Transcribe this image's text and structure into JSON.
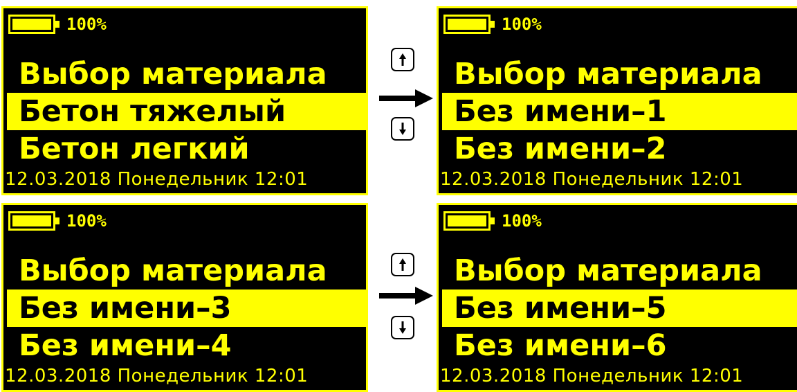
{
  "colors": {
    "screen_bg": "#000000",
    "accent": "#ffff00",
    "selected_text": "#000000",
    "page_bg": "#ffffff"
  },
  "screens": [
    {
      "battery": {
        "percent_label": "100%",
        "level": 1.0
      },
      "title": "Выбор материала",
      "items": [
        "Бетон тяжелый",
        "Бетон легкий"
      ],
      "selected_index": 0,
      "footer": "12.03.2018  Понедельник  12:01"
    },
    {
      "battery": {
        "percent_label": "100%",
        "level": 1.0
      },
      "title": "Выбор материала",
      "items": [
        "Без имени–1",
        "Без имени–2"
      ],
      "selected_index": 0,
      "footer": "12.03.2018  Понедельник  12:01"
    },
    {
      "battery": {
        "percent_label": "100%",
        "level": 1.0
      },
      "title": "Выбор материала",
      "items": [
        "Без имени–3",
        "Без имени–4"
      ],
      "selected_index": 0,
      "footer": "12.03.2018  Понедельник  12:01"
    },
    {
      "battery": {
        "percent_label": "100%",
        "level": 1.0
      },
      "title": "Выбор материала",
      "items": [
        "Без имени–5",
        "Без имени–6"
      ],
      "selected_index": 0,
      "footer": "12.03.2018  Понедельник  12:01"
    }
  ],
  "keys": {
    "up_icon": "arrow-up-icon",
    "down_icon": "arrow-down-icon",
    "transition_icon": "arrow-right-icon"
  }
}
